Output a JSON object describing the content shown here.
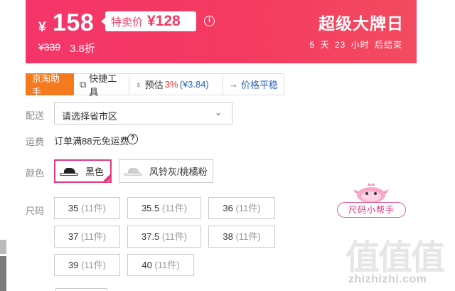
{
  "banner": {
    "currency": "¥",
    "price": "158",
    "special_label": "特卖价",
    "special_price": "¥128",
    "info_icon": "info-icon",
    "original_price": "¥339",
    "discount": "3.8折",
    "sale_title": "超级大牌日",
    "countdown": {
      "days": "5",
      "days_unit": "天",
      "hours": "23",
      "hours_unit": "小时",
      "suffix": "后结束"
    }
  },
  "toolbar": {
    "assistant": "京淘助手",
    "quick_tools": "快捷工具",
    "estimate_label": "预估",
    "estimate_pct": "3%",
    "estimate_amount": "(¥3.84)",
    "price_compare": "价格平稳"
  },
  "delivery": {
    "label": "配送",
    "placeholder": "请选择省市区"
  },
  "shipping": {
    "label": "运费",
    "note": "订单满88元免运费"
  },
  "color": {
    "label": "颜色",
    "options": [
      {
        "name": "黑色",
        "selected": true,
        "shoe_color": "#222222"
      },
      {
        "name": "风铃灰/桃橘粉",
        "selected": false,
        "shoe_color": "#d9d9d9"
      }
    ],
    "accent": "#e4397f"
  },
  "size": {
    "label": "尺码",
    "options": [
      {
        "size": "35",
        "stock": "(11件)"
      },
      {
        "size": "35.5",
        "stock": "(11件)"
      },
      {
        "size": "36",
        "stock": "(11件)"
      },
      {
        "size": "37",
        "stock": "(11件)"
      },
      {
        "size": "37.5",
        "stock": "(11件)"
      },
      {
        "size": "38",
        "stock": "(11件)"
      },
      {
        "size": "39",
        "stock": "(11件)"
      },
      {
        "size": "40",
        "stock": "(11件)"
      }
    ]
  },
  "helper": {
    "label": "尺码小帮手"
  },
  "watermark": {
    "logo": "值值值",
    "text": "zhizhizhi.com"
  },
  "colors": {
    "banner": "#f43a60",
    "assistant_bg": "#f57a1f",
    "link_blue": "#2a62c9"
  }
}
